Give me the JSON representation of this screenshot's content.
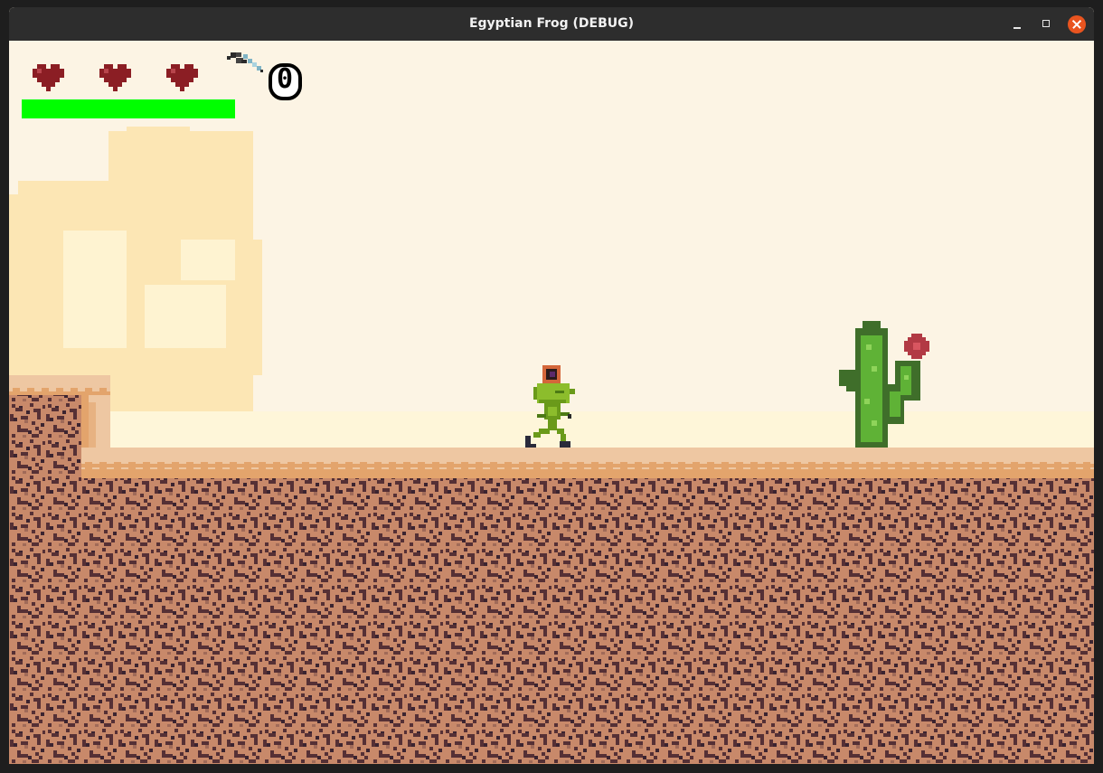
{
  "window": {
    "title": "Egyptian Frog (DEBUG)",
    "controls": [
      "minimize-icon",
      "maximize-icon",
      "close-icon"
    ]
  },
  "hud": {
    "hearts": {
      "count": 3,
      "icon": "heart-icon",
      "color": "#8b1e24"
    },
    "health_bar": {
      "fraction": 1.0,
      "color": "#00ff00"
    },
    "weapon": {
      "icon": "pickaxe-icon"
    },
    "coins": {
      "value": "0",
      "icon": "coin-icon"
    }
  },
  "scene": {
    "player": {
      "icon": "frog-character"
    },
    "obstacles": [
      {
        "icon": "cactus-icon",
        "flower_color": "#b23a44"
      }
    ],
    "background": {
      "icon": "sphinx-silhouette"
    },
    "colors": {
      "sky": "#fcf4e4",
      "dune": "#fef6d9",
      "sand_top": "#eec7a2",
      "sand_edge": "#e3a46c",
      "ground": "#c8896a",
      "ground_speckle": "#553035"
    }
  }
}
